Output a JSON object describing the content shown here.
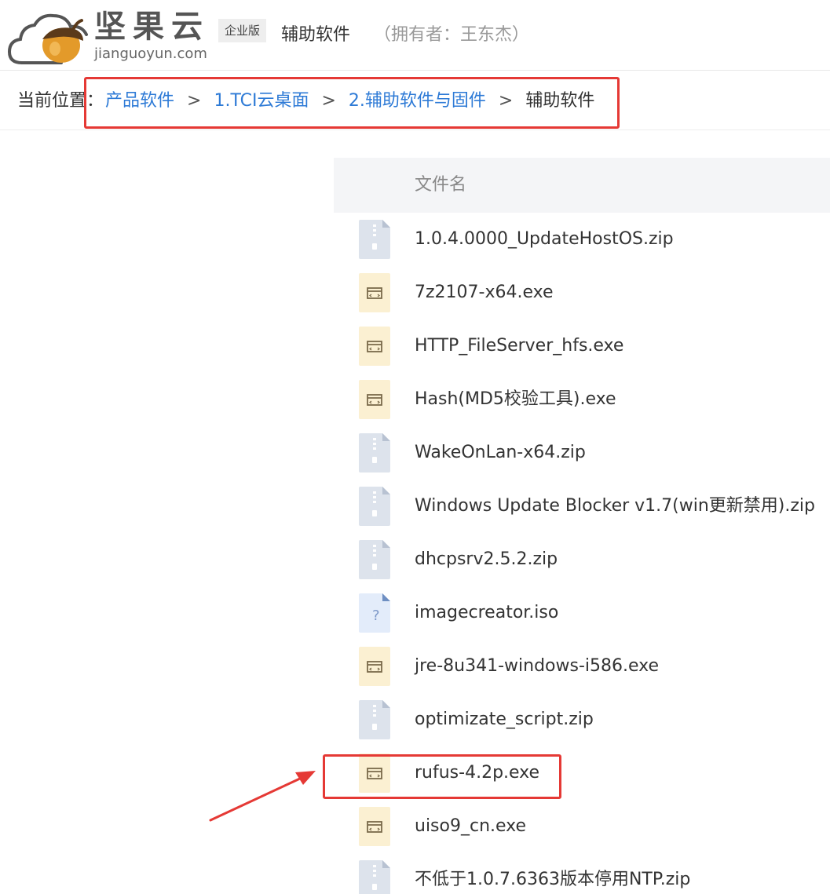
{
  "header": {
    "brand_cn": "坚果云",
    "brand_en": "jianguoyun.com",
    "edition": "企业版",
    "folder_title": "辅助软件",
    "owner": "（拥有者：王东杰）"
  },
  "breadcrumb": {
    "prefix": "当前位置：",
    "items": [
      "产品软件",
      "1.TCI云桌面",
      "2.辅助软件与固件",
      "辅助软件"
    ],
    "separator": ">"
  },
  "file_list": {
    "column_header": "文件名",
    "files": [
      {
        "name": "1.0.4.0000_UpdateHostOS.zip",
        "icon": "zip-file-icon"
      },
      {
        "name": "7z2107-x64.exe",
        "icon": "exe-file-icon"
      },
      {
        "name": "HTTP_FileServer_hfs.exe",
        "icon": "exe-file-icon"
      },
      {
        "name": "Hash(MD5校验工具).exe",
        "icon": "exe-file-icon"
      },
      {
        "name": "WakeOnLan-x64.zip",
        "icon": "zip-file-icon"
      },
      {
        "name": "Windows Update Blocker v1.7(win更新禁用).zip",
        "icon": "zip-file-icon"
      },
      {
        "name": "dhcpsrv2.5.2.zip",
        "icon": "zip-file-icon"
      },
      {
        "name": "imagecreator.iso",
        "icon": "unknown-file-icon"
      },
      {
        "name": "jre-8u341-windows-i586.exe",
        "icon": "exe-file-icon"
      },
      {
        "name": "optimizate_script.zip",
        "icon": "zip-file-icon"
      },
      {
        "name": "rufus-4.2p.exe",
        "icon": "exe-file-icon"
      },
      {
        "name": "uiso9_cn.exe",
        "icon": "exe-file-icon"
      },
      {
        "name": "不低于1.0.7.6363版本停用NTP.zip",
        "icon": "zip-file-icon"
      }
    ]
  },
  "colors": {
    "link": "#2d7ad6",
    "highlight": "#e53935",
    "zip_icon": "#dde3ec",
    "exe_icon": "#fbf0d2",
    "unknown_icon": "#e3ecfa"
  }
}
